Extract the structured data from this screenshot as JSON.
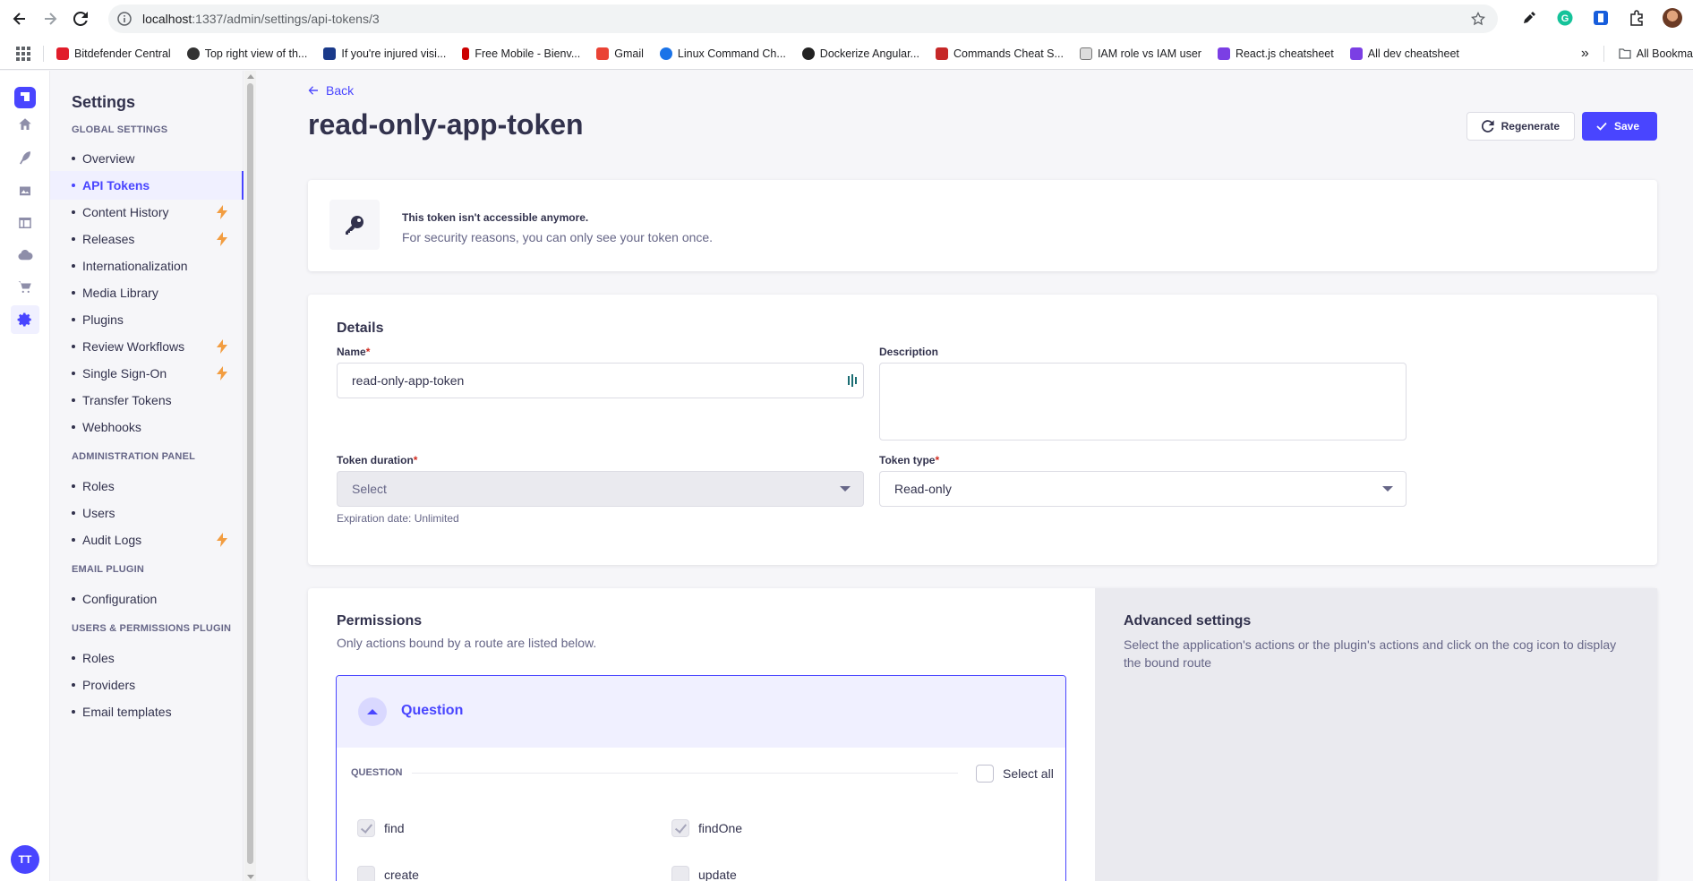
{
  "browser": {
    "url_host": "localhost",
    "url_rest": ":1337/admin/settings/api-tokens/3",
    "bookmarks": [
      {
        "label": "Bitdefender Central",
        "color": "#e11d2b"
      },
      {
        "label": "Top right view of th...",
        "color": "#333333"
      },
      {
        "label": "If you're injured visi...",
        "color": "#1a3a8a"
      },
      {
        "label": "Free Mobile - Bienv...",
        "color": "#cc0000"
      },
      {
        "label": "Gmail",
        "color": "#ea4335"
      },
      {
        "label": "Linux Command Ch...",
        "color": "#1a73e8"
      },
      {
        "label": "Dockerize Angular...",
        "color": "#222222"
      },
      {
        "label": "Commands Cheat S...",
        "color": "#c62828"
      },
      {
        "label": "IAM role vs IAM user",
        "color": "#777777"
      },
      {
        "label": "React.js cheatsheet",
        "color": "#7b3fe4"
      },
      {
        "label": "All dev cheatsheet",
        "color": "#7b3fe4"
      }
    ],
    "more_bookmarks": "»",
    "all_bookmarks": "All Bookma"
  },
  "mainnav": {
    "user_initials": "TT"
  },
  "subnav": {
    "title": "Settings",
    "sections": {
      "global": "GLOBAL SETTINGS",
      "admin": "ADMINISTRATION PANEL",
      "email": "EMAIL PLUGIN",
      "users": "USERS & PERMISSIONS PLUGIN"
    },
    "global_items": [
      "Overview",
      "API Tokens",
      "Content History",
      "Releases",
      "Internationalization",
      "Media Library",
      "Plugins",
      "Review Workflows",
      "Single Sign-On",
      "Transfer Tokens",
      "Webhooks"
    ],
    "admin_items": [
      "Roles",
      "Users",
      "Audit Logs"
    ],
    "email_items": [
      "Configuration"
    ],
    "users_items": [
      "Roles",
      "Providers",
      "Email templates"
    ]
  },
  "header": {
    "back": "Back",
    "title": "read-only-app-token",
    "regenerate": "Regenerate",
    "save": "Save"
  },
  "token_notice": {
    "title": "This token isn't accessible anymore.",
    "subtitle": "For security reasons, you can only see your token once."
  },
  "details": {
    "heading": "Details",
    "name_label": "Name",
    "name_value": "read-only-app-token",
    "description_label": "Description",
    "description_value": "",
    "duration_label": "Token duration",
    "duration_value": "Select",
    "expiration_hint": "Expiration date: Unlimited",
    "type_label": "Token type",
    "type_value": "Read-only",
    "required_mark": "*"
  },
  "permissions": {
    "heading": "Permissions",
    "subtitle": "Only actions bound by a route are listed below.",
    "accordion_title": "Question",
    "group_label": "QUESTION",
    "select_all": "Select all",
    "actions": [
      {
        "label": "find",
        "checked": true
      },
      {
        "label": "findOne",
        "checked": true
      },
      {
        "label": "create",
        "checked": false
      },
      {
        "label": "update",
        "checked": false
      }
    ]
  },
  "advanced": {
    "heading": "Advanced settings",
    "text": "Select the application's actions or the plugin's actions and click on the cog icon to display the bound route"
  },
  "colors": {
    "primary": "#4945ff",
    "bolt": "#f29d41",
    "required": "#d02b20"
  }
}
